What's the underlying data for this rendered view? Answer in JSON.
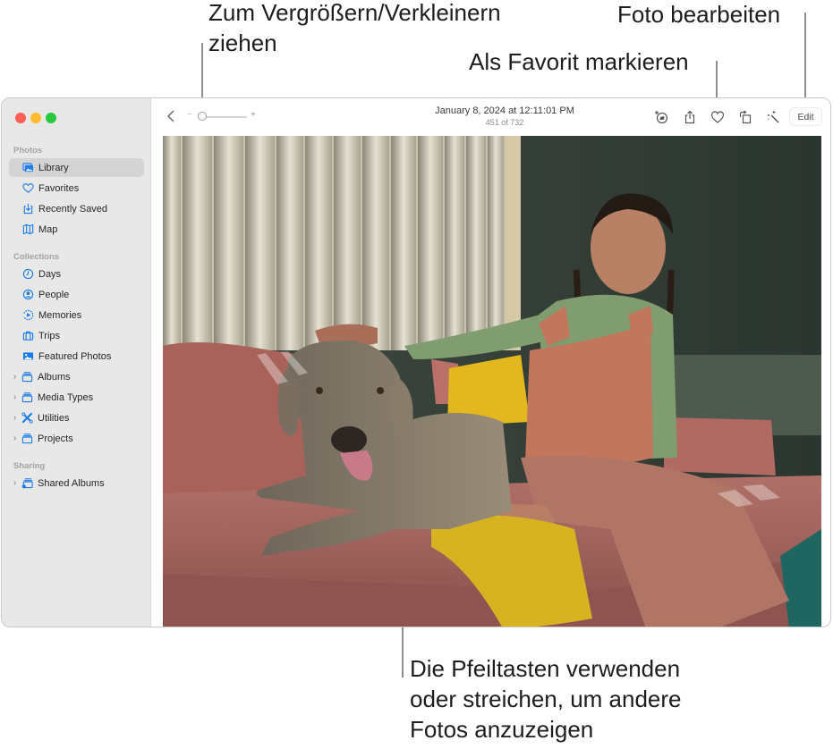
{
  "callouts": {
    "zoom": "Zum Vergrößern/Verkleinern\nziehen",
    "favorite": "Als Favorit markieren",
    "edit": "Foto bearbeiten",
    "navigate": "Die Pfeiltasten verwenden\noder streichen, um andere\nFotos anzuzeigen"
  },
  "window": {
    "traffic_lights": {
      "close": "#fe5f57",
      "minimize": "#febc2e",
      "zoom": "#28c840"
    }
  },
  "sidebar": {
    "accent": "#1a7cf0",
    "sections": [
      {
        "label": "Photos",
        "items": [
          {
            "label": "Library",
            "icon": "library-icon",
            "selected": true
          },
          {
            "label": "Favorites",
            "icon": "heart-icon"
          },
          {
            "label": "Recently Saved",
            "icon": "download-tray-icon"
          },
          {
            "label": "Map",
            "icon": "map-icon"
          }
        ]
      },
      {
        "label": "Collections",
        "items": [
          {
            "label": "Days",
            "icon": "clock-icon"
          },
          {
            "label": "People",
            "icon": "person-circle-icon"
          },
          {
            "label": "Memories",
            "icon": "memories-play-icon"
          },
          {
            "label": "Trips",
            "icon": "suitcase-icon"
          },
          {
            "label": "Featured Photos",
            "icon": "photo-icon"
          },
          {
            "label": "Albums",
            "icon": "folder-stack-icon",
            "expandable": true
          },
          {
            "label": "Media Types",
            "icon": "folder-stack-icon",
            "expandable": true
          },
          {
            "label": "Utilities",
            "icon": "tools-icon",
            "expandable": true
          },
          {
            "label": "Projects",
            "icon": "folder-stack-icon",
            "expandable": true
          }
        ]
      },
      {
        "label": "Sharing",
        "items": [
          {
            "label": "Shared Albums",
            "icon": "shared-album-icon",
            "expandable": true
          }
        ]
      }
    ]
  },
  "toolbar": {
    "back_icon": "chevron-left-icon",
    "zoom_minus": "−",
    "zoom_plus": "+",
    "zoom_level": 0.1,
    "title": "January 8, 2024 at 12:11:01 PM",
    "subtitle": "451 of 732",
    "icons": [
      "pet-identify-icon",
      "share-icon",
      "heart-icon",
      "rotate-icon",
      "magic-wand-icon"
    ],
    "edit_label": "Edit"
  },
  "photo": {
    "description": "Girl in green sweater and pink overalls petting a grey Weimaraner dog on a pink sofa"
  }
}
